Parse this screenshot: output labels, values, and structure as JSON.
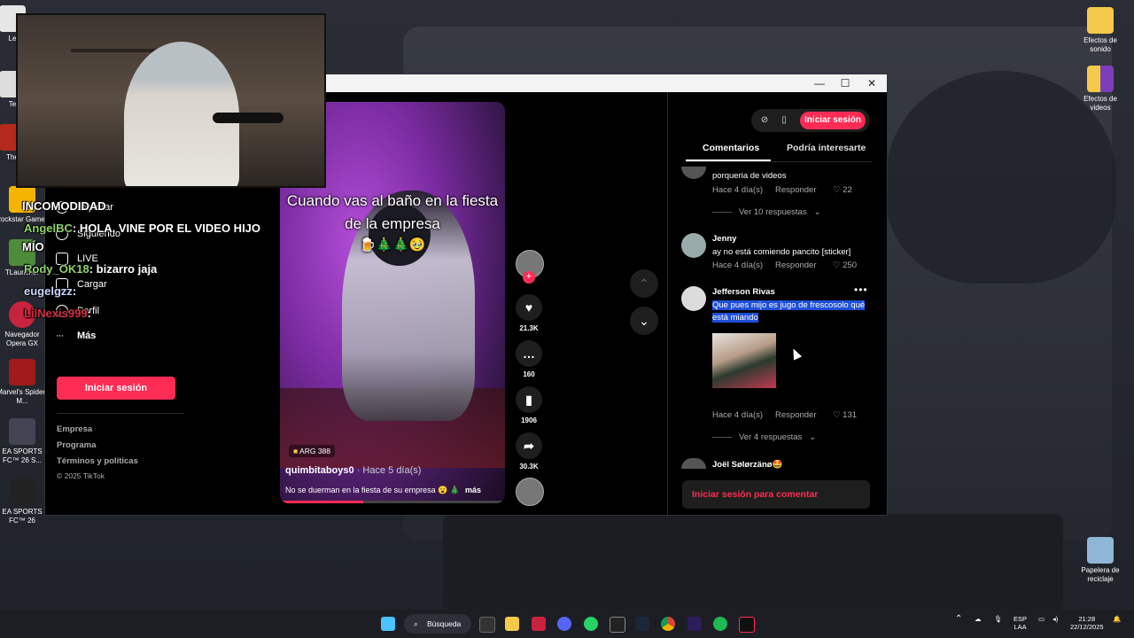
{
  "desktop": {
    "icons_left": [
      {
        "label": "Le"
      },
      {
        "label": "Te"
      },
      {
        "label": "The"
      },
      {
        "label": "Rockstar Games"
      },
      {
        "label": "TLauncher"
      },
      {
        "label": "Navegador Opera GX"
      },
      {
        "label": "Marvel's Spider-M..."
      },
      {
        "label": "EA SPORTS FC™ 26 S..."
      },
      {
        "label": "EA SPORTS FC™ 26"
      }
    ],
    "icons_right": [
      {
        "label": "Efectos de sonido"
      },
      {
        "label": "Efectos de videos"
      },
      {
        "label": "Papelera de reciclaje"
      }
    ]
  },
  "window": {
    "controls": {
      "minimize": "—",
      "maximize": "☐",
      "close": "✕"
    }
  },
  "sidebar": {
    "items": [
      {
        "label": "Explorar",
        "icon": "compass-icon"
      },
      {
        "label": "Siguiendo",
        "icon": "following-icon"
      },
      {
        "label": "LIVE",
        "icon": "live-icon"
      },
      {
        "label": "Cargar",
        "icon": "upload-icon"
      },
      {
        "label": "Perfil",
        "icon": "profile-icon"
      },
      {
        "label": "Más",
        "icon": "more-icon"
      }
    ],
    "login_button": "Iniciar sesión",
    "footer": [
      "Empresa",
      "Programa",
      "Términos y políticas",
      "© 2025 TikTok"
    ]
  },
  "video": {
    "caption_line1": "Cuando vas al baño en la fiesta",
    "caption_line2": "de la empresa",
    "caption_emojis": "🍺🎄🎄🥹",
    "badge": "ARG 388",
    "author": "quimbitaboys0",
    "time": "· Hace 5 día(s)",
    "description": "No se duerman en la fiesta de su empresa 😮 🎄",
    "more": "más",
    "progress": 0.37
  },
  "actions": {
    "likes": "21.3K",
    "comments": "160",
    "saves": "1906",
    "shares": "30.3K"
  },
  "comments_panel": {
    "signin": "Iniciar sesión",
    "tabs": [
      "Comentarios",
      "Podría interesarte"
    ],
    "comments": [
      {
        "text": "porqueria de videos",
        "time": "Hace 4 día(s)",
        "reply": "Responder",
        "likes": "22",
        "replies": "Ver 10 respuestas"
      },
      {
        "name": "Jenny",
        "text": "ay no está comiendo pancito [sticker]",
        "time": "Hace 4 día(s)",
        "reply": "Responder",
        "likes": "250"
      },
      {
        "name": "Jefferson Rivas",
        "text": "Que pues mijo es jugo de frescosolo qué está miando",
        "time": "Hace 4 día(s)",
        "reply": "Responder",
        "likes": "131",
        "replies": "Ver 4 respuestas"
      },
      {
        "name": "Joël Sølørzänø🤩"
      }
    ],
    "input_placeholder": "Iniciar sesión para comentar"
  },
  "stream_chat": [
    {
      "user": "INCOMODIDAD",
      "message": "",
      "color": "#ffffff"
    },
    {
      "user": "AngelBC",
      "message": ": HOLA, VINE POR EL VIDEO HIJO",
      "color": "#8fd16a"
    },
    {
      "user": "MÍO",
      "message": "",
      "color": "#ffffff"
    },
    {
      "user": "Rody_OK18",
      "message": ": bizarro jaja",
      "color": "#8fd16a"
    },
    {
      "user": "eugelgzz",
      "message": ":",
      "color": "#c9d3ff"
    },
    {
      "user": "LilNexis999",
      "message": ":",
      "color": "#d03040"
    }
  ],
  "taskbar": {
    "search": "Búsqueda",
    "lang": "ESP",
    "region": "LAA",
    "time": "21:28",
    "date": "22/12/2025"
  }
}
